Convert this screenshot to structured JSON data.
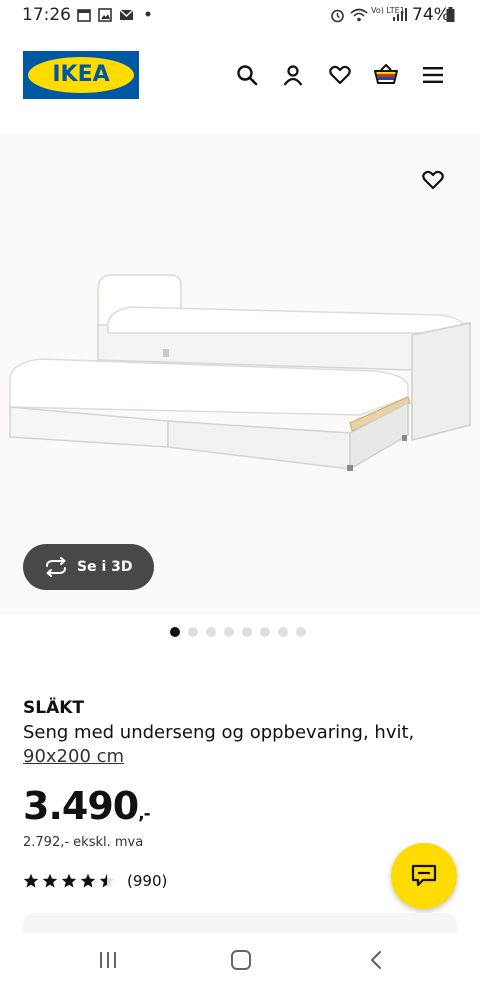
{
  "status_bar": {
    "time": "17:26",
    "battery": "74%",
    "network": "Vo) LTE1",
    "icons": [
      "calendar-icon",
      "image-icon",
      "mail-icon",
      "dot-icon",
      "alarm-icon",
      "wifi-icon",
      "signal-icon",
      "battery-icon"
    ]
  },
  "header": {
    "logo_text": "IKEA",
    "icons": [
      "search-icon",
      "account-icon",
      "heart-icon",
      "cart-icon",
      "menu-icon"
    ]
  },
  "gallery": {
    "btn_3d_label": "Se i 3D",
    "dot_count": 8,
    "active_dot": 0
  },
  "product": {
    "name": "SLÄKT",
    "description": "Seng med underseng og oppbevaring, hvit,",
    "size": "90x200 cm",
    "price_main": "3.490",
    "price_suffix": ",-",
    "price_ex_vat": "2.792,- ekskl. mva",
    "rating": 4.5,
    "rating_count": "(990)"
  },
  "colors": {
    "ikea_blue": "#0058a3",
    "ikea_yellow": "#ffdb00",
    "btn_dark": "#484848"
  }
}
